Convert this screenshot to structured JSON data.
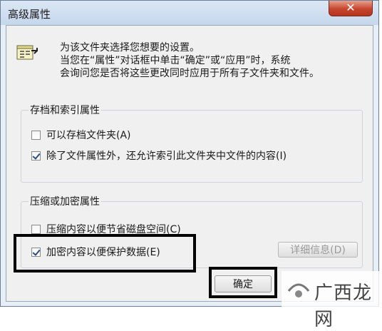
{
  "window": {
    "title": "高级属性",
    "close_glyph": "✕"
  },
  "intro": {
    "line1": "为该文件夹选择您想要的设置。",
    "line2": "当您在“属性”对话框中单击“确定”或“应用”时，系统",
    "line3": "会询问您是否将这些更改同时应用于所有子文件夹和文件。"
  },
  "archive_group": {
    "label": "存档和索引属性",
    "archive_checkbox": {
      "label": "可以存档文件夹(A)",
      "checked": false
    },
    "index_checkbox": {
      "label": "除了文件属性外，还允许索引此文件夹中文件的内容(I)",
      "checked": true
    }
  },
  "compress_group": {
    "label": "压缩或加密属性",
    "compress_checkbox": {
      "label": "压缩内容以便节省磁盘空间(C)",
      "checked": false
    },
    "encrypt_checkbox": {
      "label": "加密内容以便保护数据(E)",
      "checked": true
    },
    "details_button": "详细信息(D)"
  },
  "footer": {
    "ok_button": "确定"
  },
  "watermark": {
    "text": "广西龙网"
  },
  "colors": {
    "highlight_box": "#000000",
    "close_button": "#c7452d",
    "title_bar": "#c6d7ec"
  }
}
